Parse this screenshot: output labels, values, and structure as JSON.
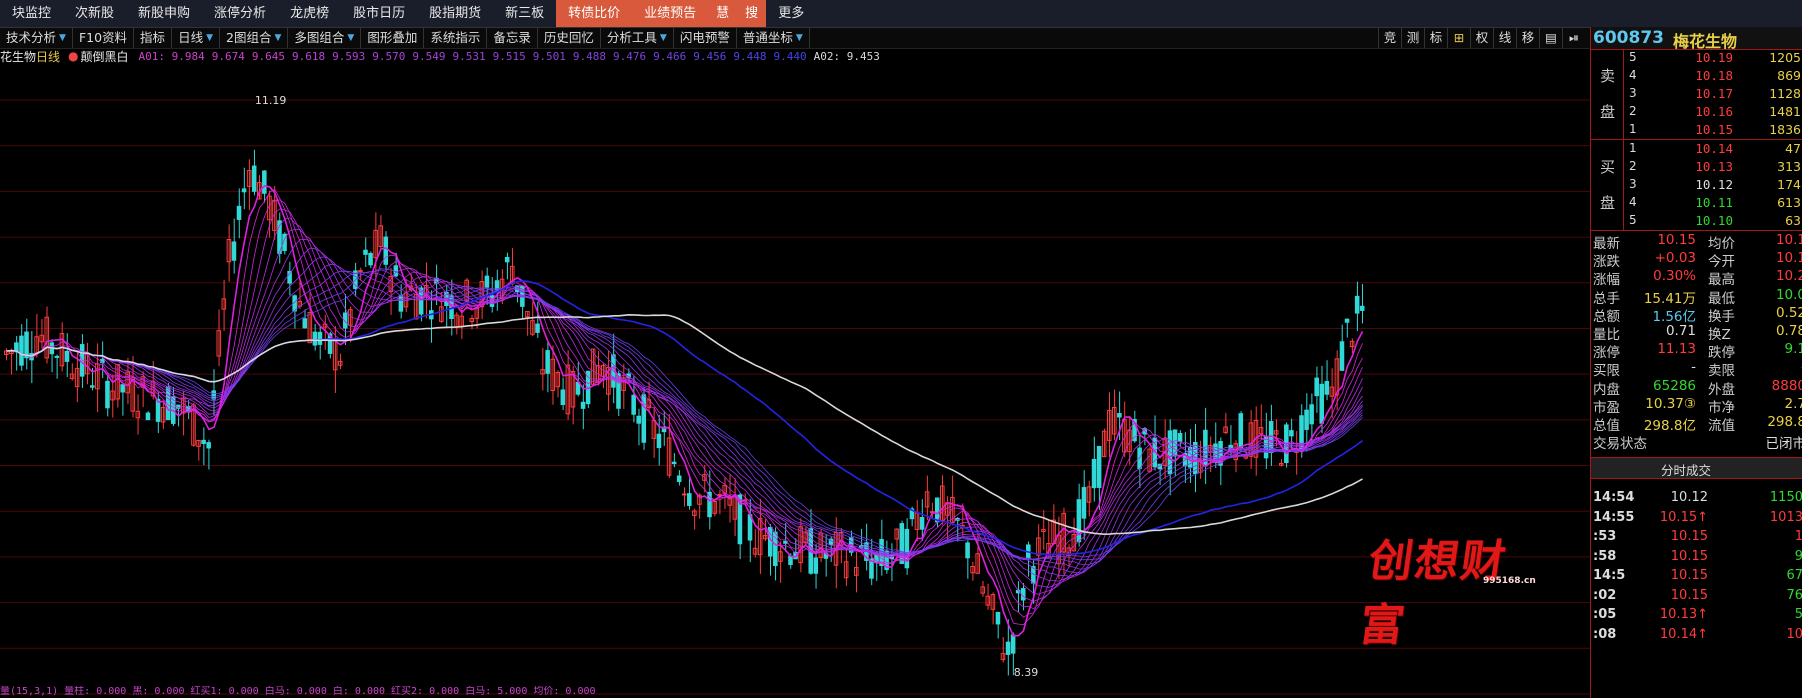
{
  "nav": [
    "块监控",
    "次新股",
    "新股申购",
    "涨停分析",
    "龙虎榜",
    "股市日历",
    "股指期货",
    "新三板",
    "转债比价",
    "业绩预告",
    "慧",
    "搜",
    "更多"
  ],
  "toolbar": [
    "技术分析",
    "F10资料",
    "指标",
    "日线",
    "2图组合",
    "多图组合",
    "图形叠加",
    "系统指示",
    "备忘录",
    "历史回忆",
    "分析工具",
    "闪电预警",
    "普通坐标"
  ],
  "right_tools": [
    "竞",
    "测",
    "标",
    "⊞",
    "权",
    "线",
    "移",
    "▤",
    "⏯"
  ],
  "legend": {
    "stock": "花生物",
    "period": "日线",
    "flip": "颠倒黑白",
    "mas": [
      {
        "label": "A01: 9.984",
        "color": "#c844c8"
      },
      {
        "label": "9.674",
        "color": "#c844c8"
      },
      {
        "label": "9.645",
        "color": "#c844c8"
      },
      {
        "label": "9.618",
        "color": "#b844d8"
      },
      {
        "label": "9.593",
        "color": "#b044d8"
      },
      {
        "label": "9.570",
        "color": "#a844d8"
      },
      {
        "label": "9.549",
        "color": "#a044d8"
      },
      {
        "label": "9.531",
        "color": "#9844d8"
      },
      {
        "label": "9.515",
        "color": "#9044d8"
      },
      {
        "label": "9.501",
        "color": "#8844d8"
      },
      {
        "label": "9.488",
        "color": "#8044d8"
      },
      {
        "label": "9.476",
        "color": "#7844d8"
      },
      {
        "label": "9.466",
        "color": "#7044e0"
      },
      {
        "label": "9.456",
        "color": "#6044e0"
      },
      {
        "label": "9.448",
        "color": "#5044e8"
      },
      {
        "label": "9.440",
        "color": "#4044e8"
      },
      {
        "label": "A02: 9.453",
        "color": "#d8d8d8"
      }
    ]
  },
  "chart_data": {
    "type": "candlestick",
    "annotations": [
      {
        "text": "11.19",
        "x": 48,
        "y": 11.19
      },
      {
        "text": "8.39",
        "x": 198,
        "y": 8.39
      }
    ],
    "ylim": [
      8.3,
      11.35
    ],
    "colors": {
      "up": "#ff3c3c",
      "down": "#31d8d8",
      "ma_a01": "#e020e0",
      "ma_slow": "#2424e8",
      "ma_a02": "#d8d8d8"
    }
  },
  "quote": {
    "code": "600873",
    "name": "梅花生物",
    "asks": [
      {
        "level": "5",
        "price": "10.19",
        "vol": "1205"
      },
      {
        "level": "4",
        "price": "10.18",
        "vol": "869"
      },
      {
        "level": "3",
        "price": "10.17",
        "vol": "1128"
      },
      {
        "level": "2",
        "price": "10.16",
        "vol": "1481"
      },
      {
        "level": "1",
        "price": "10.15",
        "vol": "1836"
      }
    ],
    "bids": [
      {
        "level": "1",
        "price": "10.14",
        "vol": "47"
      },
      {
        "level": "2",
        "price": "10.13",
        "vol": "313"
      },
      {
        "level": "3",
        "price": "10.12",
        "vol": "174"
      },
      {
        "level": "4",
        "price": "10.11",
        "vol": "613"
      },
      {
        "level": "5",
        "price": "10.10",
        "vol": "63"
      }
    ],
    "ask_side": [
      "卖",
      "盘"
    ],
    "bid_side": [
      "买",
      "盘"
    ],
    "stats": [
      {
        "l1": "最新",
        "v1": "10.15",
        "c1": "r",
        "l2": "均价",
        "v2": "10.1",
        "c2": "r"
      },
      {
        "l1": "涨跌",
        "v1": "+0.03",
        "c1": "r",
        "l2": "今开",
        "v2": "10.1",
        "c2": "r"
      },
      {
        "l1": "涨幅",
        "v1": "0.30%",
        "c1": "r",
        "l2": "最高",
        "v2": "10.2",
        "c2": "r"
      },
      {
        "l1": "总手",
        "v1": "15.41万",
        "c1": "y",
        "l2": "最低",
        "v2": "10.0",
        "c2": "g"
      },
      {
        "l1": "总额",
        "v1": "1.56亿",
        "c1": "c",
        "l2": "换手",
        "v2": "0.52",
        "c2": "y"
      },
      {
        "l1": "量比",
        "v1": "0.71",
        "c1": "w",
        "l2": "换Z",
        "v2": "0.78",
        "c2": "y"
      },
      {
        "l1": "涨停",
        "v1": "11.13",
        "c1": "r",
        "l2": "跌停",
        "v2": "9.1",
        "c2": "g"
      },
      {
        "l1": "买限",
        "v1": "-",
        "c1": "w",
        "l2": "卖限",
        "v2": "-",
        "c2": "w"
      },
      {
        "l1": "内盘",
        "v1": "65286",
        "c1": "g",
        "l2": "外盘",
        "v2": "8880",
        "c2": "r"
      },
      {
        "l1": "市盈",
        "v1": "10.37③",
        "c1": "y",
        "l2": "市净",
        "v2": "2.7",
        "c2": "y"
      },
      {
        "l1": "总值",
        "v1": "298.8亿",
        "c1": "y",
        "l2": "流值",
        "v2": "298.8",
        "c2": "y"
      },
      {
        "l1": "交易状态",
        "v1": "",
        "c1": "w",
        "l2": "",
        "v2": "已闭市",
        "c2": "w"
      }
    ],
    "ticks_header": "分时成交",
    "ticks": [
      {
        "t": "14:54",
        "p": "10.12",
        "pc": "w",
        "v": "1150",
        "vc": "g"
      },
      {
        "t": "14:55",
        "p": "10.15↑",
        "pc": "r",
        "v": "1013",
        "vc": "r"
      },
      {
        "t": ":53",
        "p": "10.15",
        "pc": "r",
        "v": "1",
        "vc": "r"
      },
      {
        "t": ":58",
        "p": "10.15",
        "pc": "r",
        "v": "9",
        "vc": "g"
      },
      {
        "t": "14:5",
        "p": "10.15",
        "pc": "r",
        "v": "67",
        "vc": "g"
      },
      {
        "t": ":02",
        "p": "10.15",
        "pc": "r",
        "v": "76",
        "vc": "g"
      },
      {
        "t": ":05",
        "p": "10.13↑",
        "pc": "r",
        "v": "5",
        "vc": "g"
      },
      {
        "t": ":08",
        "p": "10.14↑",
        "pc": "r",
        "v": "10",
        "vc": "r"
      }
    ]
  },
  "watermark": {
    "text": "创想财富",
    "url": "995168.cn"
  },
  "bottom": {
    "text": "量(15,3,1)  量柱: 0.000  黑: 0.000  红买1: 0.000  白马: 0.000  白: 0.000  红买2: 0.000  白马: 5.000  均价: 0.000"
  }
}
